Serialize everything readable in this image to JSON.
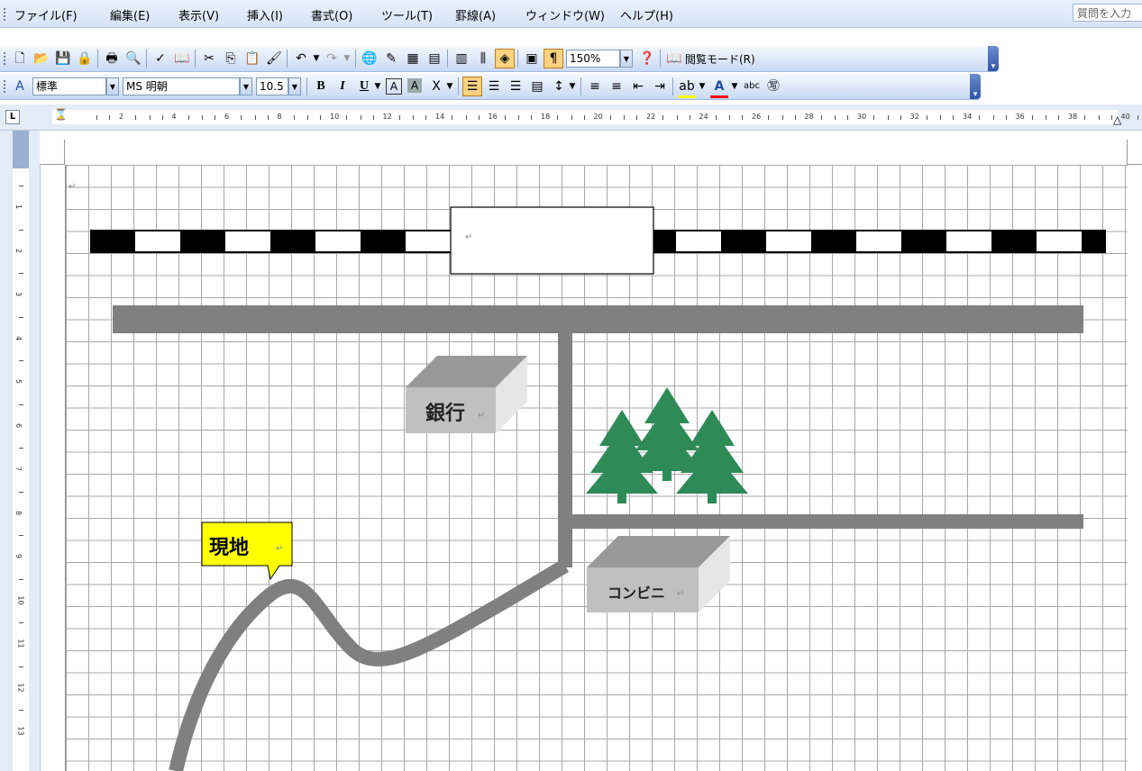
{
  "menu": {
    "items": [
      "ファイル(F)",
      "編集(E)",
      "表示(V)",
      "挿入(I)",
      "書式(O)",
      "ツール(T)",
      "罫線(A)",
      "ウィンドウ(W)",
      "ヘルプ(H)"
    ],
    "help_placeholder": "質問を入力"
  },
  "standard_toolbar": {
    "icons": [
      "new-document-icon",
      "open-folder-icon",
      "save-icon",
      "permission-icon",
      "print-icon",
      "print-preview-icon",
      "spelling-icon",
      "research-icon",
      "cut-icon",
      "copy-icon",
      "paste-icon",
      "format-painter-icon",
      "undo-icon",
      "redo-icon",
      "hyperlink-icon",
      "tables-borders-icon",
      "insert-table-icon",
      "insert-excel-icon",
      "columns-icon",
      "drawing-icon",
      "document-map-icon",
      "show-hide-icon"
    ],
    "zoom": "150%",
    "reading_mode": "閲覧モード(R)"
  },
  "formatting_toolbar": {
    "style": "標準",
    "font": "MS 明朝",
    "size": "10.5",
    "bold": "B",
    "italic": "I",
    "underline": "U"
  },
  "ruler": {
    "h_numbers": [
      "2",
      "4",
      "6",
      "8",
      "10",
      "12",
      "14",
      "16",
      "18",
      "20",
      "22",
      "24",
      "26",
      "28",
      "30",
      "32",
      "34",
      "36",
      "38",
      "40"
    ],
    "v_numbers": [
      "1",
      "2",
      "3",
      "4",
      "5",
      "6",
      "7",
      "8",
      "9",
      "10",
      "11",
      "12",
      "13"
    ]
  },
  "map": {
    "bank_label": "銀行",
    "convenience_label": "コンビニ",
    "current_location_label": "現地",
    "colors": {
      "road": "#808080",
      "tree": "#2e8b57",
      "callout": "#ffff00",
      "building_top": "#999999",
      "building_front": "#c0c0c0",
      "building_side": "#e6e6e6"
    }
  }
}
